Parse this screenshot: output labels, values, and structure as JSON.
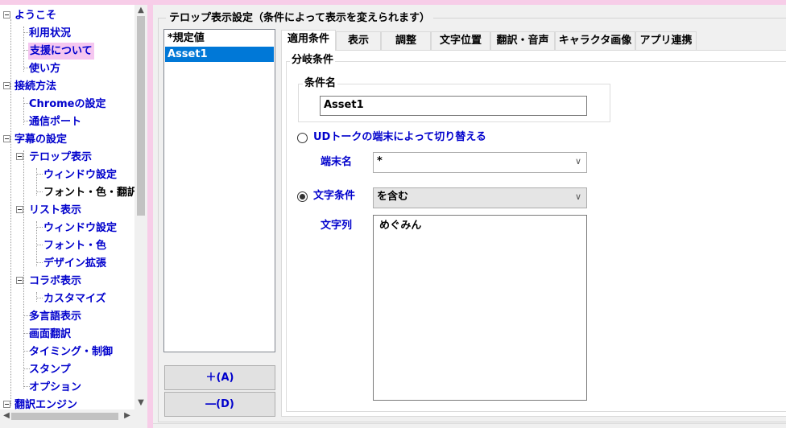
{
  "tree": {
    "items": [
      {
        "label": "ようこそ",
        "key": "welcome"
      },
      {
        "label": "利用状況",
        "key": "usage"
      },
      {
        "label": "支援について",
        "key": "support"
      },
      {
        "label": "使い方",
        "key": "howto"
      },
      {
        "label": "接続方法",
        "key": "connection"
      },
      {
        "label": "Chromeの設定",
        "key": "chrome"
      },
      {
        "label": "通信ポート",
        "key": "port"
      },
      {
        "label": "字幕の設定",
        "key": "caption"
      },
      {
        "label": "テロップ表示",
        "key": "telop"
      },
      {
        "label": "ウィンドウ設定",
        "key": "telop-window"
      },
      {
        "label": "フォント・色・翻訳",
        "key": "telop-font"
      },
      {
        "label": "リスト表示",
        "key": "list"
      },
      {
        "label": "ウィンドウ設定",
        "key": "list-window"
      },
      {
        "label": "フォント・色",
        "key": "list-font"
      },
      {
        "label": "デザイン拡張",
        "key": "list-design"
      },
      {
        "label": "コラボ表示",
        "key": "collab"
      },
      {
        "label": "カスタマイズ",
        "key": "collab-custom"
      },
      {
        "label": "多言語表示",
        "key": "multilang"
      },
      {
        "label": "画面翻訳",
        "key": "screen-translate"
      },
      {
        "label": "タイミング・制御",
        "key": "timing"
      },
      {
        "label": "スタンプ",
        "key": "stamp"
      },
      {
        "label": "オプション",
        "key": "option"
      },
      {
        "label": "翻訳エンジン",
        "key": "engine"
      }
    ],
    "selected": "support",
    "current": "telop-font"
  },
  "group_title": "テロップ表示設定（条件によって表示を変えられます）",
  "list": {
    "items": [
      "*規定値",
      "Asset1"
    ],
    "selected_index": 1
  },
  "buttons": {
    "add": "＋(A)",
    "delete": "―(D)"
  },
  "tabs": [
    {
      "label": "適用条件",
      "active": true
    },
    {
      "label": "表示",
      "active": false
    },
    {
      "label": "調整",
      "active": false
    },
    {
      "label": "文字位置",
      "active": false
    },
    {
      "label": "翻訳・音声",
      "active": false
    },
    {
      "label": "キャラクタ画像",
      "active": false
    },
    {
      "label": "アプリ連携",
      "active": false
    }
  ],
  "condition": {
    "section_title": "分岐条件",
    "name_group_title": "条件名",
    "name_value": "Asset1",
    "radio_ud": {
      "label": "UDトークの端末によって切り替える",
      "checked": false
    },
    "terminal_label": "端末名",
    "terminal_value": "*",
    "radio_text": {
      "label": "文字条件",
      "checked": true
    },
    "match_mode": "を含む",
    "string_label": "文字列",
    "string_value": "めぐみん"
  },
  "colors": {
    "pink_accent": "#f7cde8",
    "tree_selected_bg": "#f5c6f0",
    "link_blue": "#0000cc",
    "list_selected_bg": "#0078d7"
  }
}
